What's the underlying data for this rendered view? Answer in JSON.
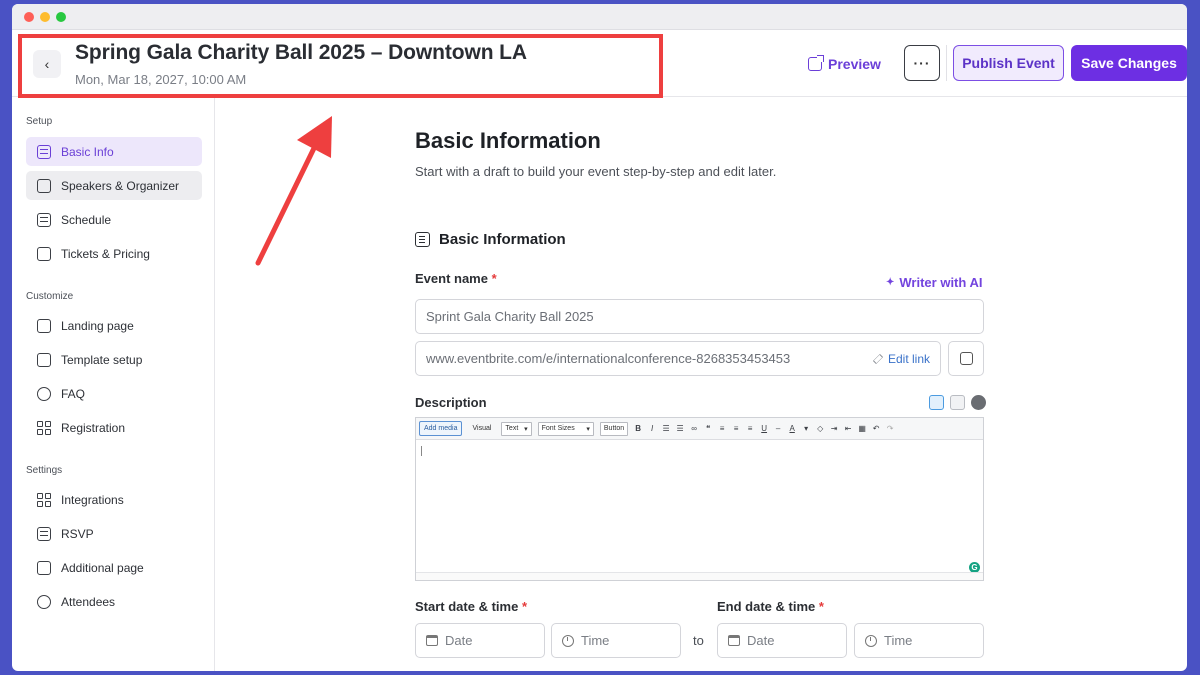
{
  "header": {
    "back_icon": "chevron-left-icon",
    "title": "Spring Gala Charity Ball 2025 – Downtown LA",
    "date": "Mon, Mar 18, 2027, 10:00 AM",
    "preview_label": "Preview",
    "more_label": "···",
    "publish_label": "Publish Event",
    "save_label": "Save Changes",
    "highlight_color": "#ee3f3f"
  },
  "sidebar": {
    "sections": [
      {
        "title": "Setup",
        "items": [
          {
            "label": "Basic Info",
            "icon": "list-icon",
            "state": "active"
          },
          {
            "label": "Speakers & Organizer",
            "icon": "speaker-icon",
            "state": "hover"
          },
          {
            "label": "Schedule",
            "icon": "clipboard-icon",
            "state": ""
          },
          {
            "label": "Tickets & Pricing",
            "icon": "ticket-icon",
            "state": ""
          }
        ]
      },
      {
        "title": "Customize",
        "items": [
          {
            "label": "Landing page",
            "icon": "landing-icon",
            "state": ""
          },
          {
            "label": "Template setup",
            "icon": "template-icon",
            "state": ""
          },
          {
            "label": "FAQ",
            "icon": "faq-icon",
            "state": ""
          },
          {
            "label": "Registration",
            "icon": "grid-icon",
            "state": ""
          }
        ]
      },
      {
        "title": "Settings",
        "items": [
          {
            "label": "Integrations",
            "icon": "grid-icon",
            "state": ""
          },
          {
            "label": "RSVP",
            "icon": "list-icon",
            "state": ""
          },
          {
            "label": "Additional page",
            "icon": "page-icon",
            "state": ""
          },
          {
            "label": "Attendees",
            "icon": "user-icon",
            "state": ""
          }
        ]
      }
    ]
  },
  "main": {
    "heading": "Basic Information",
    "subheading": "Start with a draft to build your event step-by-step and edit later.",
    "section_title": "Basic Information",
    "event_name_label": "Event name",
    "required_mark": "*",
    "ai_label": "Writer with AI",
    "event_name_value": "Sprint Gala Charity Ball 2025",
    "url_value": "www.eventbrite.com/e/internationalconference-8268353453453",
    "edit_link_label": "Edit link",
    "description_label": "Description",
    "editor_toolbar": {
      "add_media": "Add media",
      "visual": "Visual",
      "text_select": "Text",
      "font_sizes": "Font Sizes",
      "button": "Button"
    },
    "start_label": "Start date & time",
    "end_label": "End date & time",
    "date_placeholder": "Date",
    "time_placeholder": "Time",
    "to_label": "to"
  }
}
